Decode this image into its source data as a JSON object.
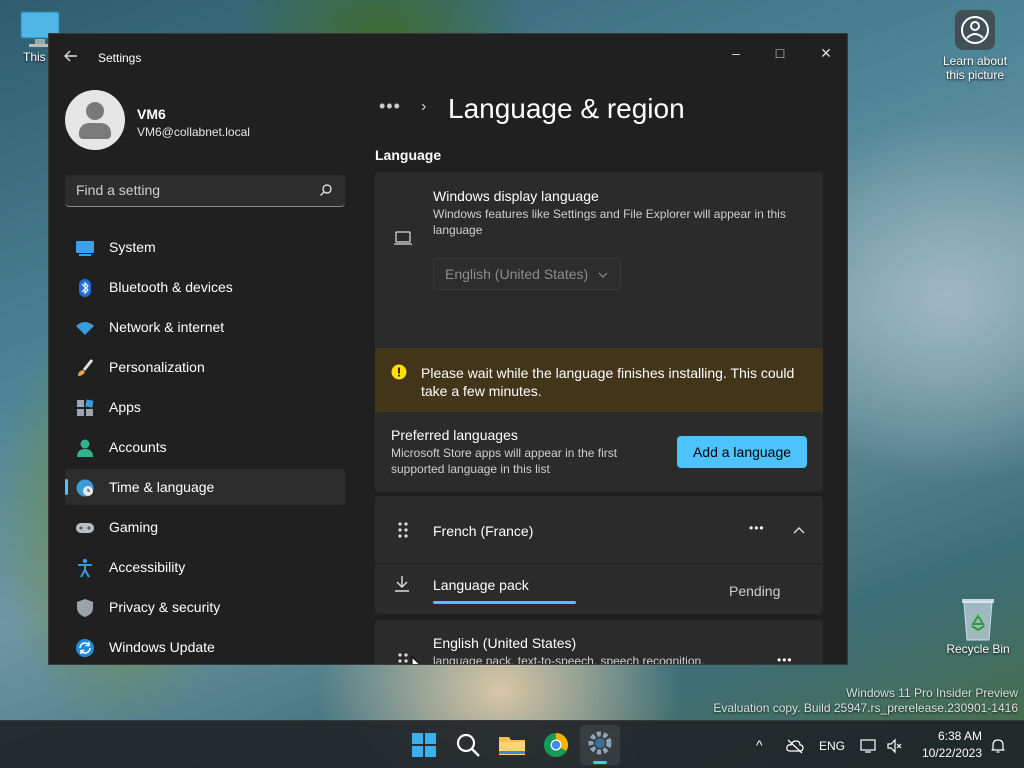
{
  "desktop": {
    "this_pc_label": "This P",
    "learn_label_1": "Learn about",
    "learn_label_2": "this picture",
    "recycle_label": "Recycle Bin",
    "watermark_1": "Windows 11 Pro Insider Preview",
    "watermark_2": "Evaluation copy. Build 25947.rs_prerelease.230901-1416"
  },
  "window": {
    "title": "Settings",
    "minimize": "–",
    "maximize": "□",
    "close": "✕"
  },
  "user": {
    "name": "VM6",
    "email": "VM6@collabnet.local"
  },
  "search": {
    "placeholder": "Find a setting"
  },
  "nav": {
    "items": [
      {
        "label": "System",
        "icon": "monitor-icon"
      },
      {
        "label": "Bluetooth & devices",
        "icon": "bluetooth-icon"
      },
      {
        "label": "Network & internet",
        "icon": "wifi-icon"
      },
      {
        "label": "Personalization",
        "icon": "brush-icon"
      },
      {
        "label": "Apps",
        "icon": "apps-icon"
      },
      {
        "label": "Accounts",
        "icon": "person-icon"
      },
      {
        "label": "Time & language",
        "icon": "globe-clock-icon"
      },
      {
        "label": "Gaming",
        "icon": "gamepad-icon"
      },
      {
        "label": "Accessibility",
        "icon": "accessibility-icon"
      },
      {
        "label": "Privacy & security",
        "icon": "shield-icon"
      },
      {
        "label": "Windows Update",
        "icon": "update-icon"
      }
    ],
    "active_index": 6
  },
  "main": {
    "breadcrumb_more": "•••",
    "breadcrumb_chevron": "›",
    "title": "Language & region",
    "section_language": "Language",
    "display_language": {
      "title": "Windows display language",
      "desc": "Windows features like Settings and File Explorer will appear in this language",
      "selected": "English (United States)"
    },
    "warning": {
      "text": "Please wait while the language finishes installing. This could take a few minutes."
    },
    "preferred": {
      "title": "Preferred languages",
      "desc": "Microsoft Store apps will appear in the first supported language in this list",
      "button": "Add a language"
    },
    "languages": [
      {
        "name": "French (France)",
        "more": "•••",
        "pack_label": "Language pack",
        "pack_status": "Pending",
        "pack_progress": 0.4
      },
      {
        "name": "English (United States)",
        "desc": "language pack, text-to-speech, speech recognition, handwriting, basic typing",
        "more": "•••"
      }
    ]
  },
  "taskbar": {
    "tray_chevron": "^",
    "lang": "ENG",
    "time": "6:38 AM",
    "date": "10/22/2023"
  },
  "colors": {
    "accent": "#4cc2ff",
    "window_bg": "#202020",
    "card_bg": "#2b2b2b",
    "warning_bg": "#433519",
    "warning_icon": "#fce100"
  }
}
